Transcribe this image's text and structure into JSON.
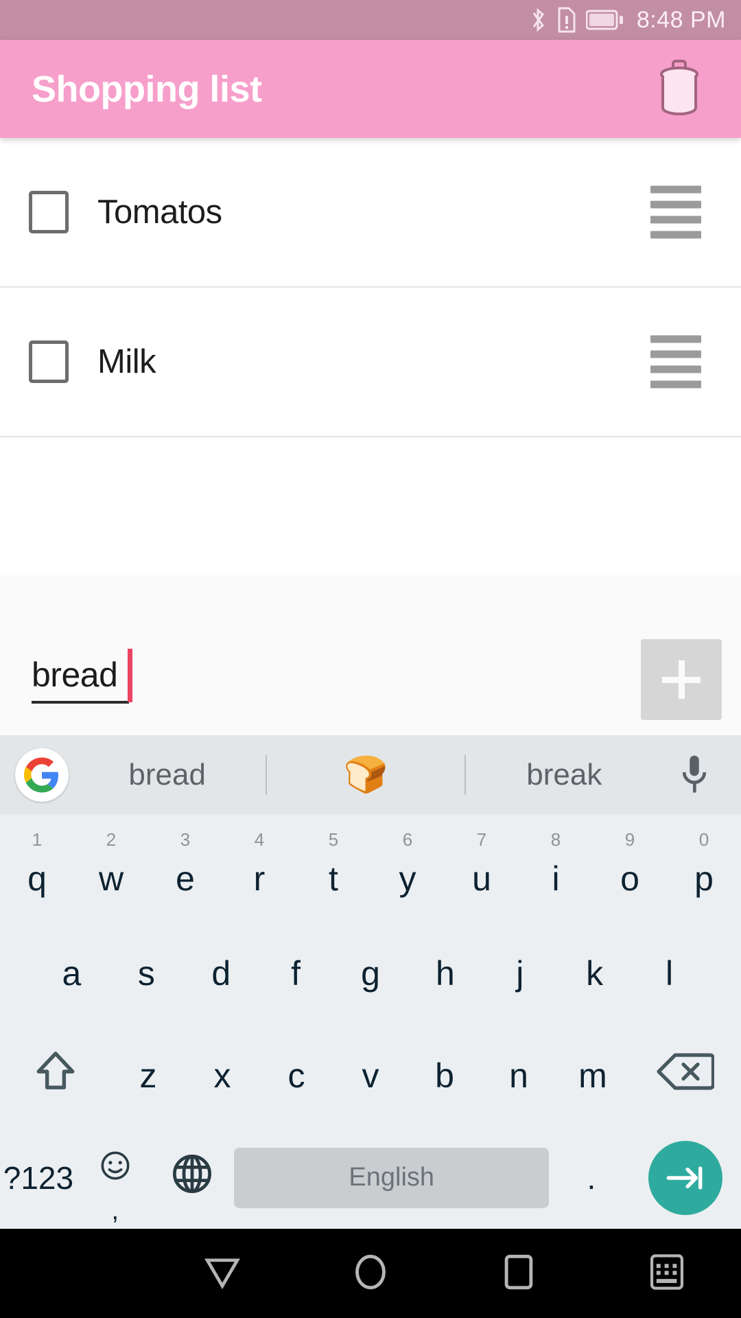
{
  "status_bar": {
    "time": "8:48 PM",
    "icons": [
      "bluetooth-icon",
      "sim-alert-icon",
      "battery-icon"
    ],
    "background": "#c28ea4"
  },
  "app_bar": {
    "title": "Shopping list",
    "delete_icon": "trash-icon",
    "background": "#f79fcb",
    "title_color": "#ffffff"
  },
  "list": {
    "items": [
      {
        "label": "Tomatos",
        "checked": false,
        "handle": "drag-handle-icon"
      },
      {
        "label": "Milk",
        "checked": false,
        "handle": "drag-handle-icon"
      }
    ]
  },
  "input": {
    "value": "bread",
    "placeholder": "",
    "add_button_icon": "plus-icon",
    "caret_color": "#ec4461"
  },
  "suggestion_bar": {
    "logo": "google-g-icon",
    "items": [
      {
        "type": "text",
        "label": "bread"
      },
      {
        "type": "emoji",
        "label": "🍞"
      },
      {
        "type": "text",
        "label": "break"
      }
    ],
    "mic_icon": "microphone-icon",
    "background": "#e3e6e8"
  },
  "keyboard": {
    "row1": [
      {
        "key": "q",
        "num": "1"
      },
      {
        "key": "w",
        "num": "2"
      },
      {
        "key": "e",
        "num": "3"
      },
      {
        "key": "r",
        "num": "4"
      },
      {
        "key": "t",
        "num": "5"
      },
      {
        "key": "y",
        "num": "6"
      },
      {
        "key": "u",
        "num": "7"
      },
      {
        "key": "i",
        "num": "8"
      },
      {
        "key": "o",
        "num": "9"
      },
      {
        "key": "p",
        "num": "0"
      }
    ],
    "row2": [
      {
        "key": "a"
      },
      {
        "key": "s"
      },
      {
        "key": "d"
      },
      {
        "key": "f"
      },
      {
        "key": "g"
      },
      {
        "key": "h"
      },
      {
        "key": "j"
      },
      {
        "key": "k"
      },
      {
        "key": "l"
      }
    ],
    "row3": {
      "shift_icon": "shift-icon",
      "keys": [
        {
          "key": "z"
        },
        {
          "key": "x"
        },
        {
          "key": "c"
        },
        {
          "key": "v"
        },
        {
          "key": "b"
        },
        {
          "key": "n"
        },
        {
          "key": "m"
        }
      ],
      "backspace_icon": "backspace-icon"
    },
    "row4": {
      "symbols_label": "?123",
      "emoji_icon": "emoji-smiley-icon",
      "comma_label": ",",
      "language_icon": "globe-icon",
      "space_label": "English",
      "period_label": ".",
      "enter_icon": "enter-tab-icon",
      "enter_color": "#2eab9e"
    },
    "background": "#eceff1"
  },
  "nav_bar": {
    "buttons": [
      {
        "icon": "back-triangle-icon",
        "name": "back"
      },
      {
        "icon": "home-circle-icon",
        "name": "home"
      },
      {
        "icon": "recents-square-icon",
        "name": "recents"
      },
      {
        "icon": "keyboard-icon",
        "name": "hide-keyboard"
      }
    ],
    "background": "#000000"
  }
}
